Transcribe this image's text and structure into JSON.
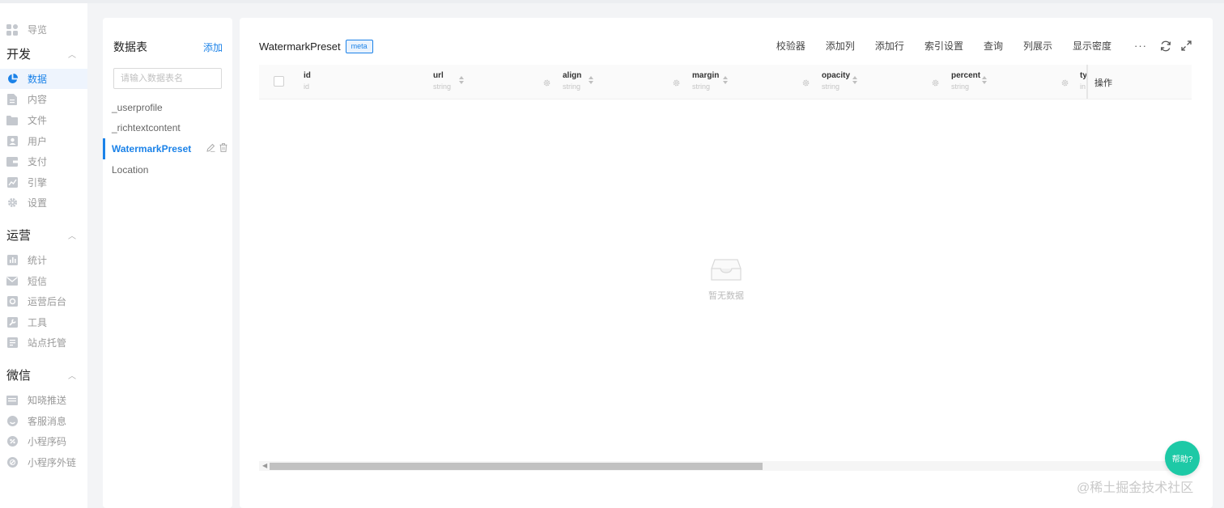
{
  "nav": {
    "overview": "导览",
    "groups": [
      {
        "title": "开发",
        "items": [
          {
            "label": "数据",
            "icon": "pie-chart-icon",
            "active": true
          },
          {
            "label": "内容",
            "icon": "document-icon"
          },
          {
            "label": "文件",
            "icon": "folder-icon"
          },
          {
            "label": "用户",
            "icon": "user-card-icon"
          },
          {
            "label": "支付",
            "icon": "wallet-icon"
          },
          {
            "label": "引擎",
            "icon": "trend-chart-icon"
          },
          {
            "label": "设置",
            "icon": "gear-icon"
          }
        ]
      },
      {
        "title": "运营",
        "items": [
          {
            "label": "统计",
            "icon": "bar-chart-icon"
          },
          {
            "label": "短信",
            "icon": "mail-icon"
          },
          {
            "label": "运营后台",
            "icon": "console-icon"
          },
          {
            "label": "工具",
            "icon": "wrench-icon"
          },
          {
            "label": "站点托管",
            "icon": "site-icon"
          }
        ]
      },
      {
        "title": "微信",
        "items": [
          {
            "label": "知晓推送",
            "icon": "push-icon"
          },
          {
            "label": "客服消息",
            "icon": "service-icon"
          },
          {
            "label": "小程序码",
            "icon": "qrcode-icon"
          },
          {
            "label": "小程序外链",
            "icon": "link-icon"
          }
        ]
      }
    ]
  },
  "tables": {
    "title": "数据表",
    "add_label": "添加",
    "search_placeholder": "请输入数据表名",
    "items": [
      {
        "name": "_userprofile"
      },
      {
        "name": "_richtextcontent"
      },
      {
        "name": "WatermarkPreset",
        "active": true
      },
      {
        "name": "Location"
      }
    ]
  },
  "main": {
    "table_name": "WatermarkPreset",
    "tag": "meta",
    "toolbar": [
      "校验器",
      "添加列",
      "添加行",
      "索引设置",
      "查询",
      "列展示",
      "显示密度"
    ],
    "more": "···",
    "columns": [
      {
        "name": "id",
        "type": "id"
      },
      {
        "name": "url",
        "type": "string"
      },
      {
        "name": "align",
        "type": "string"
      },
      {
        "name": "margin",
        "type": "string"
      },
      {
        "name": "opacity",
        "type": "string"
      },
      {
        "name": "percent",
        "type": "string"
      },
      {
        "name": "ty",
        "type": "in"
      }
    ],
    "operation_label": "操作",
    "empty_text": "暂无数据"
  },
  "help_label": "帮助?",
  "watermark": "@稀土掘金技术社区",
  "colors": {
    "accent": "#1b82e8",
    "help": "#1dc9a6"
  }
}
